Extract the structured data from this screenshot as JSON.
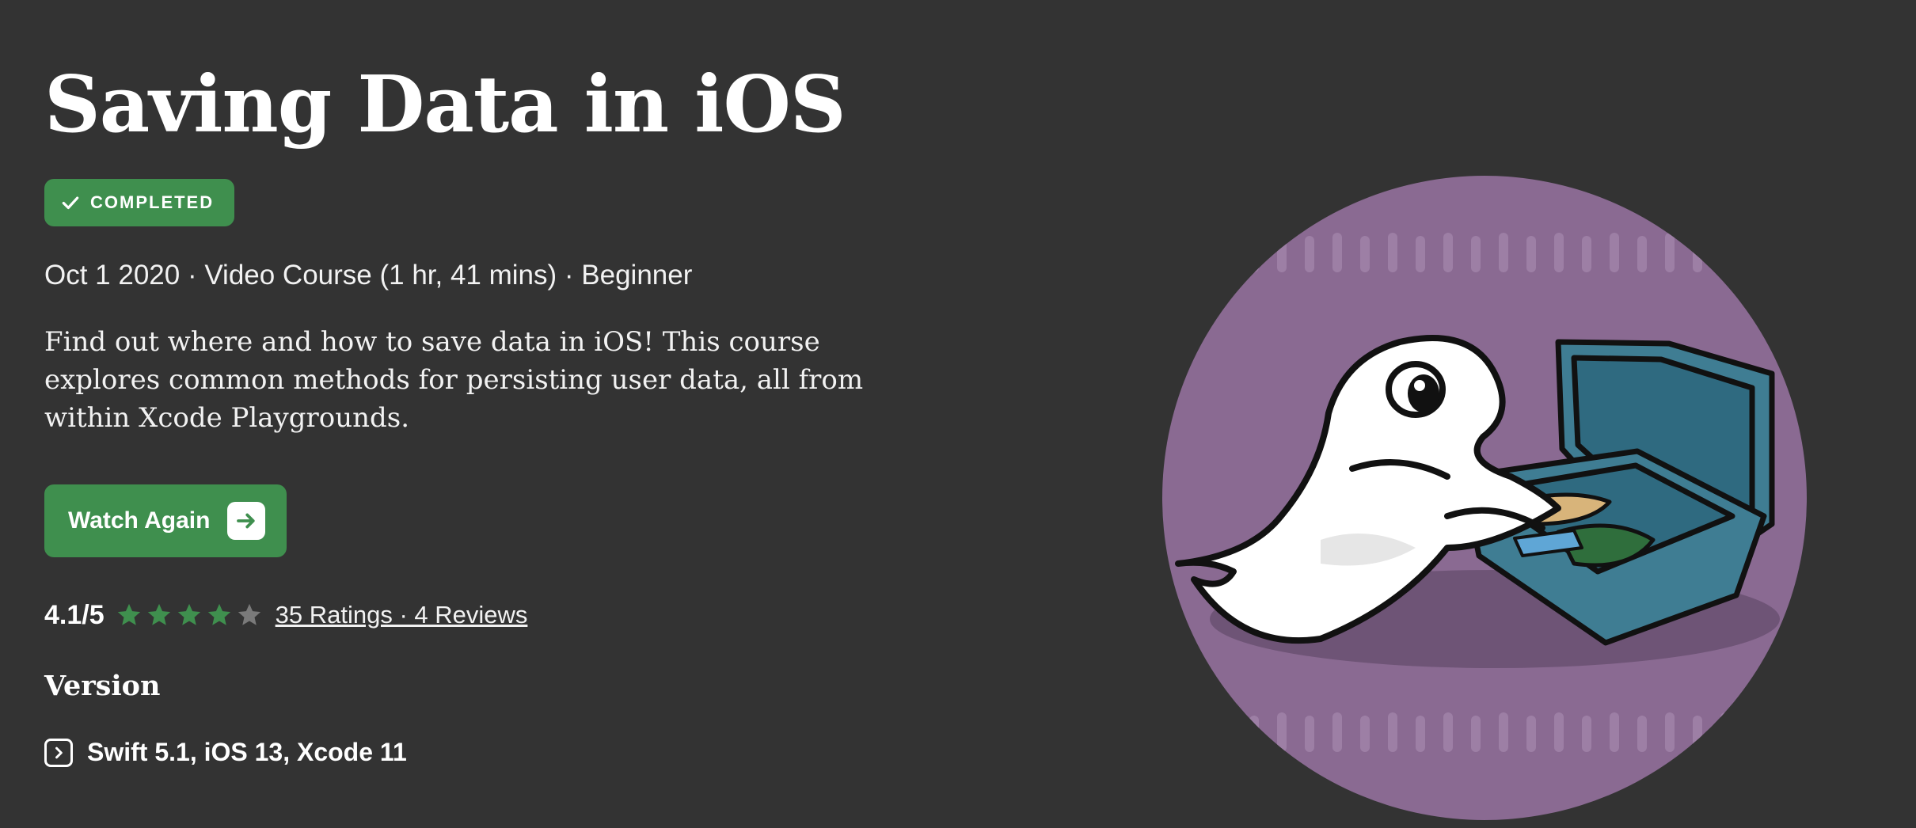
{
  "course": {
    "title": "Saving Data in iOS",
    "status_badge": "COMPLETED",
    "meta": "Oct 1 2020 · Video Course (1 hr, 41 mins) · Beginner",
    "description": "Find out where and how to save data in iOS! This course explores common methods for persisting user data, all from within Xcode Playgrounds."
  },
  "actions": {
    "watch_again": "Watch Again"
  },
  "rating": {
    "score": "4.1/5",
    "stars_filled": 4,
    "stars_total": 5,
    "ratings_link": "35 Ratings · 4 Reviews"
  },
  "version": {
    "heading": "Version",
    "details": "Swift 5.1, iOS 13, Xcode 11"
  },
  "colors": {
    "background": "#333333",
    "accent_green": "#3f8f4e",
    "star_filled": "#3f8f4e",
    "star_empty": "#7a7a7a",
    "illustration_bg": "#8a6a92"
  },
  "icons": {
    "badge": "check-icon",
    "button": "arrow-right-icon",
    "version": "chevron-right-icon",
    "stars": "star-icon"
  }
}
